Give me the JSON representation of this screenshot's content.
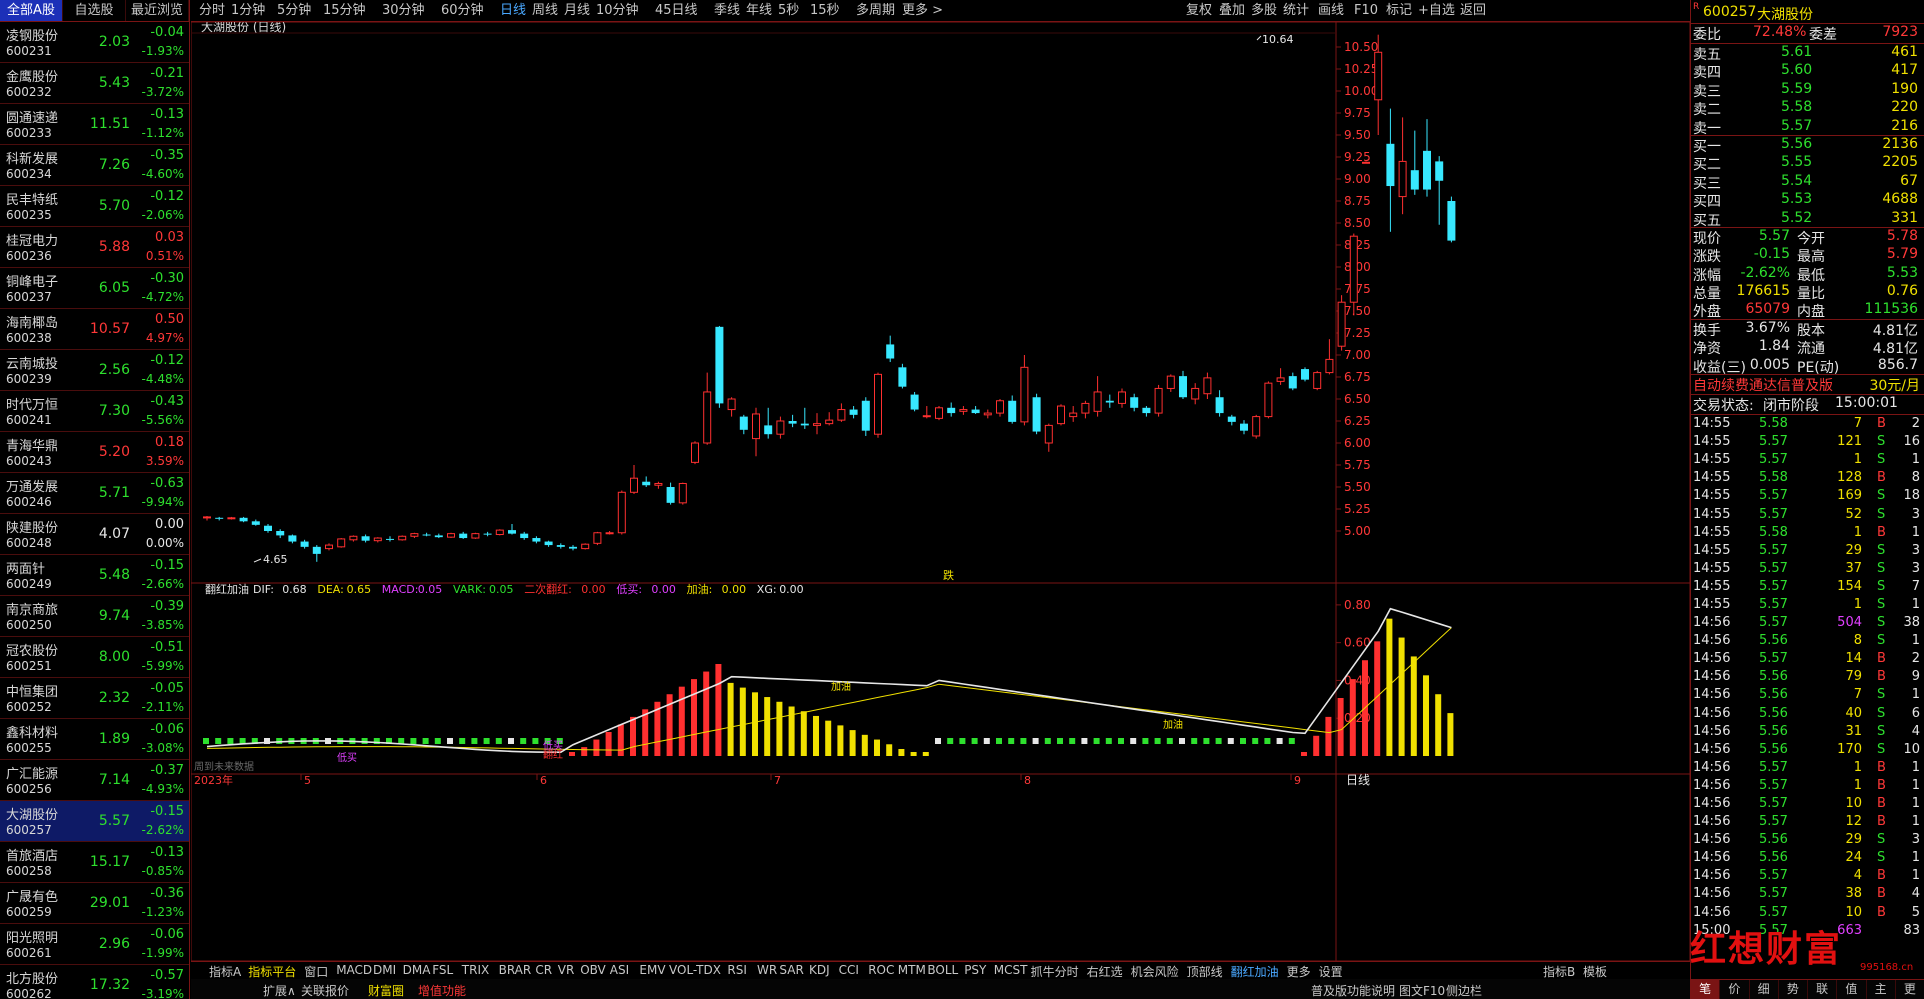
{
  "left_tabs": [
    "全部A股",
    "自选股",
    "最近浏览"
  ],
  "stocks": [
    {
      "name": "凌钢股份",
      "code": "600231",
      "price": "2.03",
      "chg": "-0.04",
      "pct": "-1.93%",
      "dir": "down"
    },
    {
      "name": "金鹰股份",
      "code": "600232",
      "price": "5.43",
      "chg": "-0.21",
      "pct": "-3.72%",
      "dir": "down"
    },
    {
      "name": "圆通速递",
      "code": "600233",
      "price": "11.51",
      "chg": "-0.13",
      "pct": "-1.12%",
      "dir": "down"
    },
    {
      "name": "科新发展",
      "code": "600234",
      "price": "7.26",
      "chg": "-0.35",
      "pct": "-4.60%",
      "dir": "down"
    },
    {
      "name": "民丰特纸",
      "code": "600235",
      "price": "5.70",
      "chg": "-0.12",
      "pct": "-2.06%",
      "dir": "down"
    },
    {
      "name": "桂冠电力",
      "code": "600236",
      "price": "5.88",
      "chg": "0.03",
      "pct": "0.51%",
      "dir": "up"
    },
    {
      "name": "铜峰电子",
      "code": "600237",
      "price": "6.05",
      "chg": "-0.30",
      "pct": "-4.72%",
      "dir": "down"
    },
    {
      "name": "海南椰岛",
      "code": "600238",
      "price": "10.57",
      "chg": "0.50",
      "pct": "4.97%",
      "dir": "up"
    },
    {
      "name": "云南城投",
      "code": "600239",
      "price": "2.56",
      "chg": "-0.12",
      "pct": "-4.48%",
      "dir": "down"
    },
    {
      "name": "时代万恒",
      "code": "600241",
      "price": "7.30",
      "chg": "-0.43",
      "pct": "-5.56%",
      "dir": "down"
    },
    {
      "name": "青海华鼎",
      "code": "600243",
      "price": "5.20",
      "chg": "0.18",
      "pct": "3.59%",
      "dir": "up"
    },
    {
      "name": "万通发展",
      "code": "600246",
      "price": "5.71",
      "chg": "-0.63",
      "pct": "-9.94%",
      "dir": "down"
    },
    {
      "name": "陕建股份",
      "code": "600248",
      "price": "4.07",
      "chg": "0.00",
      "pct": "0.00%",
      "dir": "flat"
    },
    {
      "name": "两面针",
      "code": "600249",
      "price": "5.48",
      "chg": "-0.15",
      "pct": "-2.66%",
      "dir": "down"
    },
    {
      "name": "南京商旅",
      "code": "600250",
      "price": "9.74",
      "chg": "-0.39",
      "pct": "-3.85%",
      "dir": "down"
    },
    {
      "name": "冠农股份",
      "code": "600251",
      "price": "8.00",
      "chg": "-0.51",
      "pct": "-5.99%",
      "dir": "down"
    },
    {
      "name": "中恒集团",
      "code": "600252",
      "price": "2.32",
      "chg": "-0.05",
      "pct": "-2.11%",
      "dir": "down"
    },
    {
      "name": "鑫科材料",
      "code": "600255",
      "price": "1.89",
      "chg": "-0.06",
      "pct": "-3.08%",
      "dir": "down"
    },
    {
      "name": "广汇能源",
      "code": "600256",
      "price": "7.14",
      "chg": "-0.37",
      "pct": "-4.93%",
      "dir": "down"
    },
    {
      "name": "大湖股份",
      "code": "600257",
      "price": "5.57",
      "chg": "-0.15",
      "pct": "-2.62%",
      "dir": "down",
      "selected": true
    },
    {
      "name": "首旅酒店",
      "code": "600258",
      "price": "15.17",
      "chg": "-0.13",
      "pct": "-0.85%",
      "dir": "down"
    },
    {
      "name": "广晟有色",
      "code": "600259",
      "price": "29.01",
      "chg": "-0.36",
      "pct": "-1.23%",
      "dir": "down"
    },
    {
      "name": "阳光照明",
      "code": "600261",
      "price": "2.96",
      "chg": "-0.06",
      "pct": "-1.99%",
      "dir": "down"
    },
    {
      "name": "北方股份",
      "code": "600262",
      "price": "17.32",
      "chg": "-0.57",
      "pct": "-3.19%",
      "dir": "down"
    }
  ],
  "periods": [
    "分时",
    "1分钟",
    "5分钟",
    "15分钟",
    "30分钟",
    "60分钟",
    "日线",
    "周线",
    "月线",
    "10分钟",
    "45日线",
    "季线",
    "年线",
    "5秒",
    "15秒",
    "多周期",
    "更多 >"
  ],
  "active_period": "日线",
  "top_right_tools": [
    "复权",
    "叠加",
    "多股",
    "统计",
    "画线",
    "F10",
    "标记",
    "+自选",
    "返回"
  ],
  "chart_title": "大湖股份 (日线)",
  "kline": {
    "price_axis": [
      "10.50",
      "10.25",
      "10.00",
      "9.75",
      "9.50",
      "9.25",
      "9.00",
      "8.75",
      "8.50",
      "8.25",
      "8.00",
      "7.75",
      "7.50",
      "7.25",
      "7.00",
      "6.75",
      "6.50",
      "6.25",
      "6.00",
      "5.75",
      "5.50",
      "5.25",
      "5.00"
    ],
    "high_label": "10.64",
    "low_label": "4.65",
    "signal_label": "跌",
    "colors": {
      "up": "#ff3030",
      "down": "#38e8ff"
    }
  },
  "indicator": {
    "name": "翻红加油",
    "legend": [
      {
        "k": "DIF:",
        "v": "0.68",
        "color": "#e6e6e6"
      },
      {
        "k": "DEA:",
        "v": "0.65",
        "color": "#f0e000"
      },
      {
        "k": "MACD:",
        "v": "0.05",
        "color": "#e040ff"
      },
      {
        "k": "VARK:",
        "v": "0.05",
        "color": "#2ee02e"
      },
      {
        "k": "二次翻红:",
        "v": "0.00",
        "color": "#ff3030"
      },
      {
        "k": "低买:",
        "v": "0.00",
        "color": "#e040ff"
      },
      {
        "k": "加油:",
        "v": "0.00",
        "color": "#f0e000"
      },
      {
        "k": "XG:",
        "v": "0.00",
        "color": "#e6e6e6"
      }
    ],
    "axis": [
      "0.80",
      "0.60",
      "0.40",
      "0.20"
    ],
    "labels": {
      "buy1": "低买",
      "buy2": "低买",
      "red": "翻红",
      "oil1": "加油",
      "oil2": "加油"
    }
  },
  "time_axis": [
    "2023年",
    "5",
    "6",
    "7",
    "8",
    "9"
  ],
  "period_mode": "日线",
  "hint": "周到未来数据",
  "bottom_tabs": [
    "指标A",
    "指标平台",
    "窗口",
    "MACD",
    "DMI",
    "DMA",
    "FSL",
    "TRIX",
    "BRAR",
    "CR",
    "VR",
    "OBV",
    "ASI",
    "EMV",
    "VOL-TDX",
    "RSI",
    "WR",
    "SAR",
    "KDJ",
    "CCI",
    "ROC",
    "MTM",
    "BOLL",
    "PSY",
    "MCST",
    "抓牛分时",
    "右红选",
    "机会风险",
    "顶部线",
    "翻红加油",
    "更多",
    "设置"
  ],
  "bottom_right_tabs": [
    "指标B",
    "模板"
  ],
  "bottom2_tabs": [
    "扩展∧",
    "关联报价",
    "财富圈",
    "增值功能"
  ],
  "bottom2_right": [
    "普及版功能说明",
    "图文F10",
    "侧边栏"
  ],
  "quote": {
    "code": "600257",
    "name": "大湖股份",
    "weibi_label": "委比",
    "weibi": "72.48%",
    "weicha_label": "委差",
    "weicha": "7923",
    "sells": [
      {
        "l": "卖五",
        "p": "5.61",
        "v": "461"
      },
      {
        "l": "卖四",
        "p": "5.60",
        "v": "417"
      },
      {
        "l": "卖三",
        "p": "5.59",
        "v": "190"
      },
      {
        "l": "卖二",
        "p": "5.58",
        "v": "220"
      },
      {
        "l": "卖一",
        "p": "5.57",
        "v": "216"
      }
    ],
    "buys": [
      {
        "l": "买一",
        "p": "5.56",
        "v": "2136"
      },
      {
        "l": "买二",
        "p": "5.55",
        "v": "2205"
      },
      {
        "l": "买三",
        "p": "5.54",
        "v": "67"
      },
      {
        "l": "买四",
        "p": "5.53",
        "v": "4688"
      },
      {
        "l": "买五",
        "p": "5.52",
        "v": "331"
      }
    ],
    "stats": [
      {
        "l1": "现价",
        "v1": "5.57",
        "c1": "g",
        "l2": "今开",
        "v2": "5.78",
        "c2": "r"
      },
      {
        "l1": "涨跌",
        "v1": "-0.15",
        "c1": "g",
        "l2": "最高",
        "v2": "5.79",
        "c2": "r"
      },
      {
        "l1": "涨幅",
        "v1": "-2.62%",
        "c1": "g",
        "l2": "最低",
        "v2": "5.53",
        "c2": "g"
      },
      {
        "l1": "总量",
        "v1": "176615",
        "c1": "y",
        "l2": "量比",
        "v2": "0.76",
        "c2": "y"
      },
      {
        "l1": "外盘",
        "v1": "65079",
        "c1": "r",
        "l2": "内盘",
        "v2": "111536",
        "c2": "g"
      }
    ],
    "stats2": [
      {
        "l1": "换手",
        "v1": "3.67%",
        "l2": "股本",
        "v2": "4.81亿"
      },
      {
        "l1": "净资",
        "v1": "1.84",
        "l2": "流通",
        "v2": "4.81亿"
      },
      {
        "l1": "收益(三)",
        "v1": "0.005",
        "l2": "PE(动)",
        "v2": "856.7"
      }
    ],
    "promo": "自动续费通达信普及版",
    "promo_price": "30元/月",
    "status_label": "交易状态:",
    "status": "闭市阶段",
    "status_time": "15:00:01",
    "ticks": [
      [
        "14:55",
        "5.58",
        "7",
        "B",
        "2"
      ],
      [
        "14:55",
        "5.57",
        "121",
        "S",
        "16"
      ],
      [
        "14:55",
        "5.57",
        "1",
        "S",
        "1"
      ],
      [
        "14:55",
        "5.58",
        "128",
        "B",
        "8"
      ],
      [
        "14:55",
        "5.57",
        "169",
        "S",
        "18"
      ],
      [
        "14:55",
        "5.57",
        "52",
        "S",
        "3"
      ],
      [
        "14:55",
        "5.58",
        "1",
        "B",
        "1"
      ],
      [
        "14:55",
        "5.57",
        "29",
        "S",
        "3"
      ],
      [
        "14:55",
        "5.57",
        "37",
        "S",
        "3"
      ],
      [
        "14:55",
        "5.57",
        "154",
        "S",
        "7"
      ],
      [
        "14:55",
        "5.57",
        "1",
        "S",
        "1"
      ],
      [
        "14:56",
        "5.57",
        "504",
        "S",
        "38"
      ],
      [
        "14:56",
        "5.56",
        "8",
        "S",
        "1"
      ],
      [
        "14:56",
        "5.57",
        "14",
        "B",
        "2"
      ],
      [
        "14:56",
        "5.56",
        "79",
        "B",
        "9"
      ],
      [
        "14:56",
        "5.56",
        "7",
        "S",
        "1"
      ],
      [
        "14:56",
        "5.56",
        "40",
        "S",
        "6"
      ],
      [
        "14:56",
        "5.56",
        "31",
        "S",
        "4"
      ],
      [
        "14:56",
        "5.56",
        "170",
        "S",
        "10"
      ],
      [
        "14:56",
        "5.57",
        "1",
        "B",
        "1"
      ],
      [
        "14:56",
        "5.57",
        "1",
        "B",
        "1"
      ],
      [
        "14:56",
        "5.57",
        "10",
        "B",
        "1"
      ],
      [
        "14:56",
        "5.57",
        "12",
        "B",
        "1"
      ],
      [
        "14:56",
        "5.56",
        "29",
        "S",
        "3"
      ],
      [
        "14:56",
        "5.56",
        "24",
        "S",
        "1"
      ],
      [
        "14:56",
        "5.57",
        "4",
        "B",
        "1"
      ],
      [
        "14:56",
        "5.57",
        "38",
        "B",
        "4"
      ],
      [
        "14:56",
        "5.57",
        "10",
        "B",
        "5"
      ],
      [
        "15:00",
        "5.57",
        "663",
        "",
        "83"
      ]
    ],
    "bottom_tabs": [
      "笔",
      "价",
      "细",
      "势",
      "联",
      "值",
      "主",
      "更"
    ]
  },
  "watermark": "红想财富",
  "watermark_url": "995168.cn"
}
